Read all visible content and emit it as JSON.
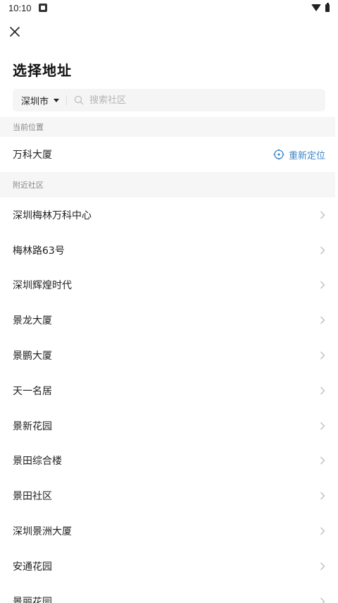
{
  "status_bar": {
    "time": "10:10"
  },
  "header": {
    "title": "选择地址",
    "close_icon": "close-icon"
  },
  "search": {
    "city": "深圳市",
    "placeholder": "搜索社区"
  },
  "current_section": {
    "label": "当前位置",
    "location_name": "万科大厦",
    "relocate_label": "重新定位"
  },
  "nearby_section": {
    "label": "附近社区",
    "items": [
      "深圳梅林万科中心",
      "梅林路63号",
      "深圳辉煌时代",
      "景龙大厦",
      "景鹏大厦",
      "天一名居",
      "景新花园",
      "景田综合楼",
      "景田社区",
      "深圳景洲大厦",
      "安通花园",
      "景丽花园"
    ]
  },
  "colors": {
    "accent": "#3b86c8",
    "section_bg": "#f6f6f6",
    "search_bg": "#f5f5f5"
  }
}
